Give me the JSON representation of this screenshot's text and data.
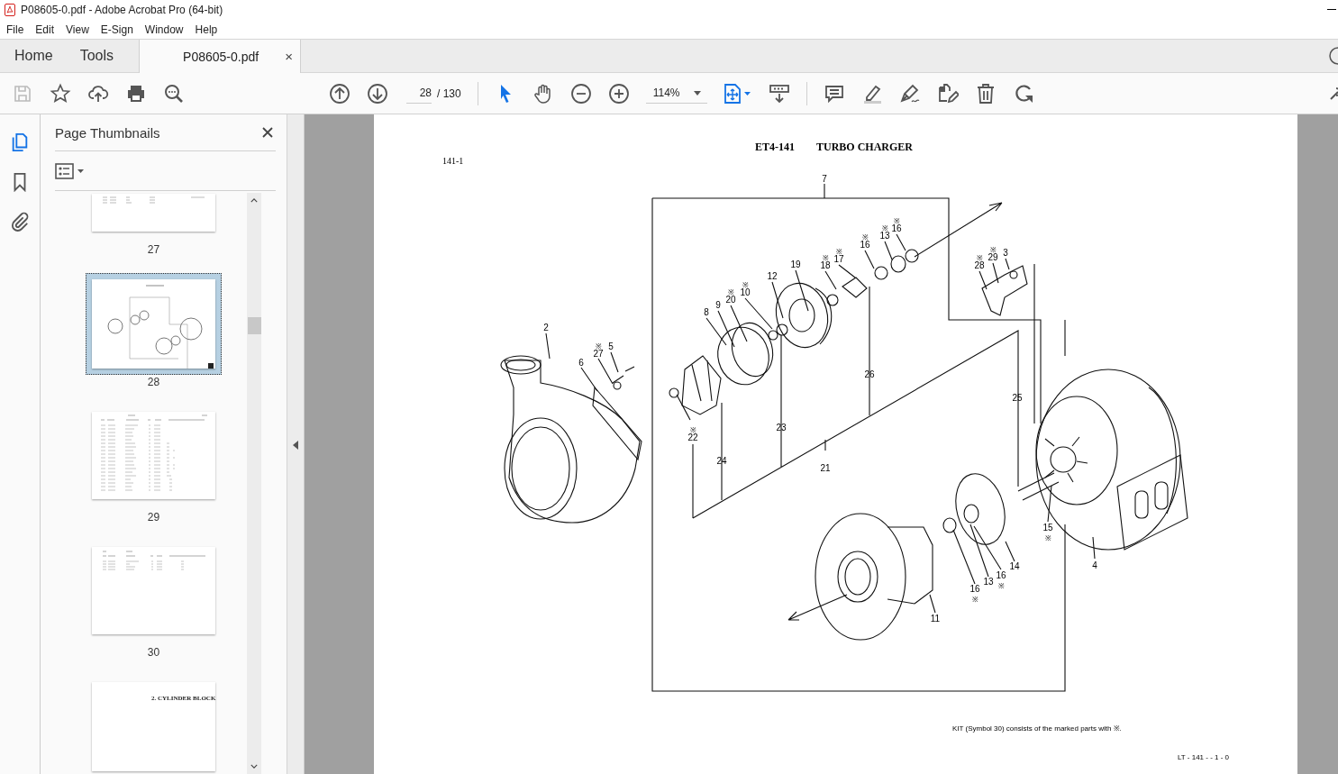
{
  "window": {
    "title": "P08605-0.pdf - Adobe Acrobat Pro (64-bit)"
  },
  "menu": [
    "File",
    "Edit",
    "View",
    "E-Sign",
    "Window",
    "Help"
  ],
  "tabs": [
    {
      "label": "Home",
      "selected": false
    },
    {
      "label": "Tools",
      "selected": false
    },
    {
      "label": "P08605-0.pdf",
      "selected": true,
      "close": "×"
    }
  ],
  "toolbar": {
    "page_field": "28",
    "page_total": "/ 130",
    "zoom": "114%"
  },
  "rail": [
    {
      "kind": "pages",
      "selected": true
    },
    {
      "kind": "bookmarks",
      "selected": false
    },
    {
      "kind": "attachments",
      "selected": false
    }
  ],
  "panel": {
    "title": "Page Thumbnails",
    "thumbnails": [
      {
        "kind": "list",
        "label": "27",
        "selected": false
      },
      {
        "kind": "diagram",
        "label": "28",
        "selected": true
      },
      {
        "kind": "table",
        "label": "29",
        "selected": false
      },
      {
        "kind": "short-table",
        "label": "30",
        "selected": false
      },
      {
        "kind": "heading",
        "heading": "2. CYLINDER BLOCK",
        "selected": false
      }
    ]
  },
  "document": {
    "section": "141-1",
    "code": "ET4-141",
    "title": "TURBO CHARGER",
    "callouts": [
      {
        "number": "7"
      },
      {
        "number": "16",
        "mark": "※"
      },
      {
        "number": "13",
        "mark": "※"
      },
      {
        "number": "16",
        "mark": "※"
      },
      {
        "number": "17",
        "mark": "※"
      },
      {
        "number": "19"
      },
      {
        "number": "18",
        "mark": "※"
      },
      {
        "number": "12"
      },
      {
        "number": "10",
        "mark": "※"
      },
      {
        "number": "20",
        "mark": "※"
      },
      {
        "number": "9"
      },
      {
        "number": "8"
      },
      {
        "number": "28",
        "mark": "※"
      },
      {
        "number": "29",
        "mark": "※"
      },
      {
        "number": "3"
      },
      {
        "number": "2"
      },
      {
        "number": "5"
      },
      {
        "number": "27",
        "mark": "※"
      },
      {
        "number": "6"
      },
      {
        "number": "26"
      },
      {
        "number": "25"
      },
      {
        "number": "23"
      },
      {
        "number": "22",
        "mark": "※"
      },
      {
        "number": "24"
      },
      {
        "number": "21"
      },
      {
        "number": "15",
        "mark": "※"
      },
      {
        "number": "4"
      },
      {
        "number": "14"
      },
      {
        "number": "16",
        "mark": "※"
      },
      {
        "number": "13"
      },
      {
        "number": "16",
        "mark": "※"
      },
      {
        "number": "11"
      }
    ],
    "footnote": "KIT (Symbol 30) consists of the marked parts with ※.",
    "page_code": "LT - 141 - - 1 - 0"
  }
}
